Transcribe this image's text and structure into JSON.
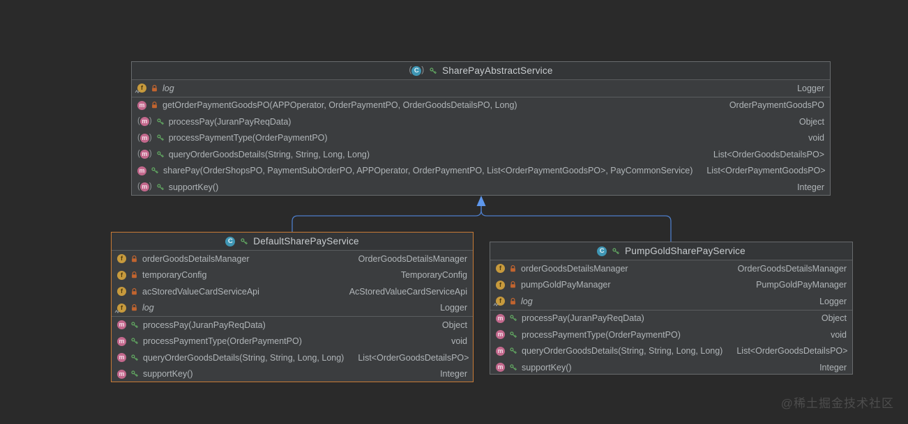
{
  "watermark": "@稀土掘金技术社区",
  "colors": {
    "page_background": "#2a2a2a",
    "node_body": "#3b3d3f",
    "node_header": "#343638",
    "node_border": "#696c6e",
    "node_border_selected": "#c97b35",
    "separator": "#5a5d5f",
    "member_text": "#b0b5b8",
    "title_text": "#c9cdd0",
    "connector_line": "#4d7dc9",
    "connector_arrow": "#5e97ec",
    "method_icon": "#c2688c",
    "field_icon": "#c79a3d",
    "class_icon": "#3f96b4",
    "lock_icon": "#c1642f",
    "key_icon": "#61a661"
  },
  "classes": [
    {
      "title": "SharePayAbstractService",
      "abstract": true,
      "selected": false,
      "fields": [
        {
          "name": "log",
          "type": "Logger",
          "static": true,
          "visibility": "locked",
          "abstract": false
        }
      ],
      "methods": [
        {
          "name": "getOrderPaymentGoodsPO(APPOperator, OrderPaymentPO, OrderGoodsDetailsPO, Long)",
          "type": "OrderPaymentGoodsPO",
          "static": false,
          "visibility": "locked",
          "abstract": false
        },
        {
          "name": "processPay(JuranPayReqData)",
          "type": "Object",
          "static": false,
          "visibility": "public",
          "abstract": true
        },
        {
          "name": "processPaymentType(OrderPaymentPO)",
          "type": "void",
          "static": false,
          "visibility": "public",
          "abstract": true
        },
        {
          "name": "queryOrderGoodsDetails(String, String, Long, Long)",
          "type": "List<OrderGoodsDetailsPO>",
          "static": false,
          "visibility": "public",
          "abstract": true
        },
        {
          "name": "sharePay(OrderShopsPO, PaymentSubOrderPO, APPOperator, OrderPaymentPO, List<OrderPaymentGoodsPO>, PayCommonService)",
          "type": "List<OrderPaymentGoodsPO>",
          "static": false,
          "visibility": "public",
          "abstract": false
        },
        {
          "name": "supportKey()",
          "type": "Integer",
          "static": false,
          "visibility": "public",
          "abstract": true
        }
      ]
    },
    {
      "title": "DefaultSharePayService",
      "abstract": false,
      "selected": true,
      "fields": [
        {
          "name": "orderGoodsDetailsManager",
          "type": "OrderGoodsDetailsManager",
          "static": false,
          "visibility": "locked",
          "abstract": false
        },
        {
          "name": "temporaryConfig",
          "type": "TemporaryConfig",
          "static": false,
          "visibility": "locked",
          "abstract": false
        },
        {
          "name": "acStoredValueCardServiceApi",
          "type": "AcStoredValueCardServiceApi",
          "static": false,
          "visibility": "locked",
          "abstract": false
        },
        {
          "name": "log",
          "type": "Logger",
          "static": true,
          "visibility": "locked",
          "abstract": false
        }
      ],
      "methods": [
        {
          "name": "processPay(JuranPayReqData)",
          "type": "Object",
          "static": false,
          "visibility": "public",
          "abstract": false
        },
        {
          "name": "processPaymentType(OrderPaymentPO)",
          "type": "void",
          "static": false,
          "visibility": "public",
          "abstract": false
        },
        {
          "name": "queryOrderGoodsDetails(String, String, Long, Long)",
          "type": "List<OrderGoodsDetailsPO>",
          "static": false,
          "visibility": "public",
          "abstract": false
        },
        {
          "name": "supportKey()",
          "type": "Integer",
          "static": false,
          "visibility": "public",
          "abstract": false
        }
      ]
    },
    {
      "title": "PumpGoldSharePayService",
      "abstract": false,
      "selected": false,
      "fields": [
        {
          "name": "orderGoodsDetailsManager",
          "type": "OrderGoodsDetailsManager",
          "static": false,
          "visibility": "locked",
          "abstract": false
        },
        {
          "name": "pumpGoldPayManager",
          "type": "PumpGoldPayManager",
          "static": false,
          "visibility": "locked",
          "abstract": false
        },
        {
          "name": "log",
          "type": "Logger",
          "static": true,
          "visibility": "locked",
          "abstract": false
        }
      ],
      "methods": [
        {
          "name": "processPay(JuranPayReqData)",
          "type": "Object",
          "static": false,
          "visibility": "public",
          "abstract": false
        },
        {
          "name": "processPaymentType(OrderPaymentPO)",
          "type": "void",
          "static": false,
          "visibility": "public",
          "abstract": false
        },
        {
          "name": "queryOrderGoodsDetails(String, String, Long, Long)",
          "type": "List<OrderGoodsDetailsPO>",
          "static": false,
          "visibility": "public",
          "abstract": false
        },
        {
          "name": "supportKey()",
          "type": "Integer",
          "static": false,
          "visibility": "public",
          "abstract": false
        }
      ]
    }
  ]
}
